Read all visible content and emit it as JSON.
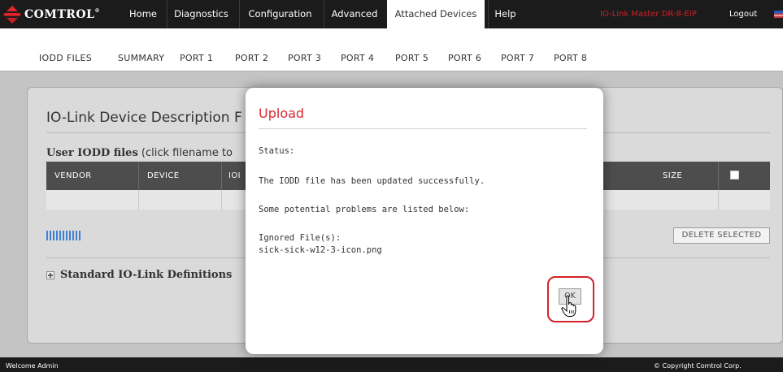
{
  "topnav": {
    "logo_text": "COMTROL",
    "logo_reg": "®",
    "tabs": [
      "Home",
      "Diagnostics",
      "Configuration",
      "Advanced",
      "Attached Devices",
      "Help"
    ],
    "active_tab": "Attached Devices",
    "device_name": "IO-Link Master DR-8-EIP",
    "logout": "Logout",
    "brand_color": "#d41f26"
  },
  "subnav": {
    "tabs": [
      "IODD FILES",
      "SUMMARY",
      "PORT 1",
      "PORT 2",
      "PORT 3",
      "PORT 4",
      "PORT 5",
      "PORT 6",
      "PORT 7",
      "PORT 8"
    ]
  },
  "page": {
    "title": "IO-Link Device Description F",
    "user_iodd_bold": "User IODD files",
    "user_iodd_rest": " (click filename to",
    "table_headers": [
      "VENDOR",
      "DEVICE",
      "IOI",
      "SIZE"
    ],
    "delete_button": "DELETE SELECTED",
    "standard_defs": "Standard IO-Link Definitions"
  },
  "modal": {
    "title": "Upload",
    "status": "Status:",
    "success": "The IODD file has been updated successfully.",
    "problems": "Some potential problems are listed below:",
    "ignored_label": "Ignored File(s):",
    "ignored_file": "sick-sick-w12-3-icon.png",
    "ok": "OK"
  },
  "footer": {
    "welcome": "Welcome Admin",
    "copyright": "© Copyright Comtrol Corp."
  }
}
